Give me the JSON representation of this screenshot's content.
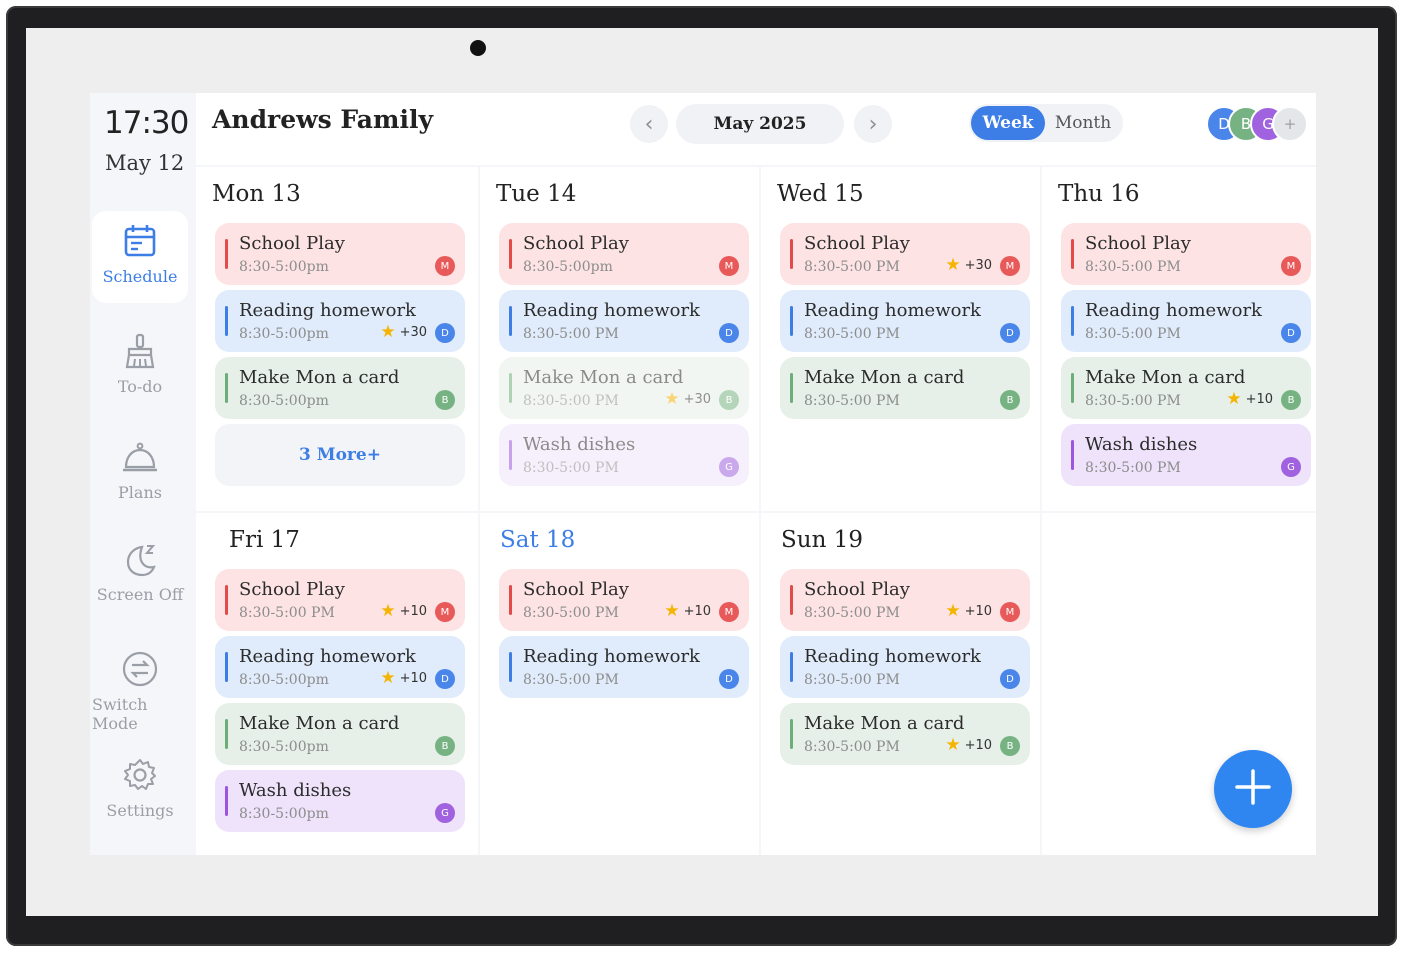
{
  "sidebar": {
    "time": "17:30",
    "date": "May 12",
    "items": [
      {
        "label": "Schedule",
        "icon": "calendar-icon",
        "active": true
      },
      {
        "label": "To-do",
        "icon": "broom-icon",
        "active": false
      },
      {
        "label": "Plans",
        "icon": "cloche-icon",
        "active": false
      },
      {
        "label": "Screen Off",
        "icon": "moon-icon",
        "active": false
      },
      {
        "label": "Switch Mode",
        "icon": "switch-icon",
        "active": false
      },
      {
        "label": "Settings",
        "icon": "gear-icon",
        "active": false
      }
    ]
  },
  "header": {
    "title": "Andrews Family",
    "month": "May 2025",
    "view_week": "Week",
    "view_month": "Month",
    "prev_icon": "chevron-left-icon",
    "next_icon": "chevron-right-icon",
    "avatars": [
      {
        "letter": "D",
        "color": "#4a86ea"
      },
      {
        "letter": "B",
        "color": "#77b382"
      },
      {
        "letter": "G",
        "color": "#a062de"
      },
      {
        "letter": "+",
        "color": "#d9dce2"
      }
    ]
  },
  "days": [
    {
      "label": "Mon 13",
      "today": false,
      "events": [
        {
          "title": "School Play",
          "time": "8:30-5:00pm",
          "color": "red",
          "member": "M",
          "points": ""
        },
        {
          "title": "Reading homework",
          "time": "8:30-5:00pm",
          "color": "blue",
          "member": "D",
          "points": "+30"
        },
        {
          "title": "Make Mon a card",
          "time": "8:30-5:00pm",
          "color": "green",
          "member": "B",
          "points": ""
        }
      ],
      "more": "3 More+"
    },
    {
      "label": "Tue 14",
      "today": false,
      "events": [
        {
          "title": "School Play",
          "time": "8:30-5:00pm",
          "color": "red",
          "member": "M",
          "points": ""
        },
        {
          "title": "Reading homework",
          "time": "8:30-5:00 PM",
          "color": "blue",
          "member": "D",
          "points": ""
        },
        {
          "title": "Make Mon a card",
          "time": "8:30-5:00 PM",
          "color": "green",
          "member": "B",
          "points": "+30",
          "faded": true
        },
        {
          "title": "Wash dishes",
          "time": "8:30-5:00 PM",
          "color": "purple",
          "member": "G",
          "points": "",
          "faded": true
        }
      ]
    },
    {
      "label": "Wed 15",
      "today": false,
      "events": [
        {
          "title": "School Play",
          "time": "8:30-5:00 PM",
          "color": "red",
          "member": "M",
          "points": "+30"
        },
        {
          "title": "Reading homework",
          "time": "8:30-5:00 PM",
          "color": "blue",
          "member": "D",
          "points": ""
        },
        {
          "title": "Make Mon a card",
          "time": "8:30-5:00 PM",
          "color": "green",
          "member": "B",
          "points": ""
        }
      ]
    },
    {
      "label": "Thu 16",
      "today": false,
      "events": [
        {
          "title": "School Play",
          "time": "8:30-5:00 PM",
          "color": "red",
          "member": "M",
          "points": ""
        },
        {
          "title": "Reading homework",
          "time": "8:30-5:00 PM",
          "color": "blue",
          "member": "D",
          "points": ""
        },
        {
          "title": "Make Mon a card",
          "time": "8:30-5:00 PM",
          "color": "green",
          "member": "B",
          "points": "+10"
        },
        {
          "title": "Wash dishes",
          "time": "8:30-5:00 PM",
          "color": "purple",
          "member": "G",
          "points": ""
        }
      ]
    },
    {
      "label": "Fri 17",
      "today": false,
      "events": [
        {
          "title": "School Play",
          "time": "8:30-5:00 PM",
          "color": "red",
          "member": "M",
          "points": "+10"
        },
        {
          "title": "Reading homework",
          "time": "8:30-5:00pm",
          "color": "blue",
          "member": "D",
          "points": "+10"
        },
        {
          "title": "Make Mon a card",
          "time": "8:30-5:00pm",
          "color": "green",
          "member": "B",
          "points": ""
        },
        {
          "title": "Wash dishes",
          "time": "8:30-5:00pm",
          "color": "purple",
          "member": "G",
          "points": ""
        }
      ]
    },
    {
      "label": "Sat 18",
      "today": true,
      "events": [
        {
          "title": "School Play",
          "time": "8:30-5:00 PM",
          "color": "red",
          "member": "M",
          "points": "+10"
        },
        {
          "title": "Reading homework",
          "time": "8:30-5:00 PM",
          "color": "blue",
          "member": "D",
          "points": ""
        }
      ]
    },
    {
      "label": "Sun 19",
      "today": false,
      "events": [
        {
          "title": "School Play",
          "time": "8:30-5:00 PM",
          "color": "red",
          "member": "M",
          "points": "+10"
        },
        {
          "title": "Reading homework",
          "time": "8:30-5:00 PM",
          "color": "blue",
          "member": "D",
          "points": ""
        },
        {
          "title": "Make Mon a card",
          "time": "8:30-5:00 PM",
          "color": "green",
          "member": "B",
          "points": "+10"
        }
      ]
    }
  ],
  "fab_icon": "plus-icon"
}
